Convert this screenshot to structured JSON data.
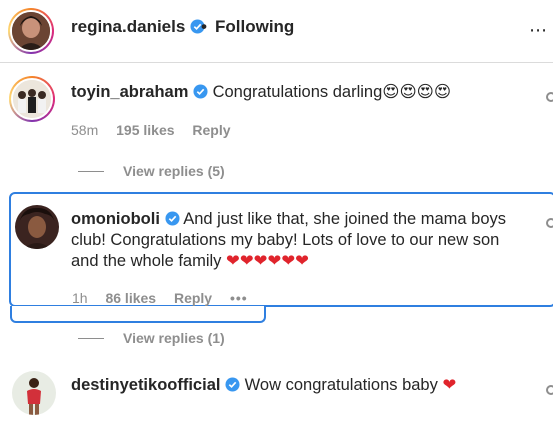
{
  "header": {
    "username": "regina.daniels",
    "separator": "•",
    "follow_status": "Following",
    "more_label": "⋯"
  },
  "comments": [
    {
      "username": "toyin_abraham",
      "text": "Congratulations darling",
      "emojis": "😍😍😍😍",
      "time": "58m",
      "likes": "195 likes",
      "reply": "Reply",
      "view_replies": "View replies (5)"
    },
    {
      "username": "omonioboli",
      "text_line1": "And just like that, she joined the mama boys",
      "text_line2": "club! Congratulations my baby! Lots of love to our new son",
      "text_line3": "and the whole family",
      "emojis": "❤❤❤❤❤❤",
      "time": "1h",
      "likes": "86 likes",
      "reply": "Reply",
      "more": "•••",
      "view_replies": "View replies (1)"
    },
    {
      "username": "destinyetikoofficial",
      "text": "Wow congratulations baby",
      "emojis": "❤"
    }
  ],
  "colors": {
    "verified_blue": "#3897f0",
    "highlight_blue": "#2f7fe0",
    "meta_gray": "#8e8e8e"
  }
}
